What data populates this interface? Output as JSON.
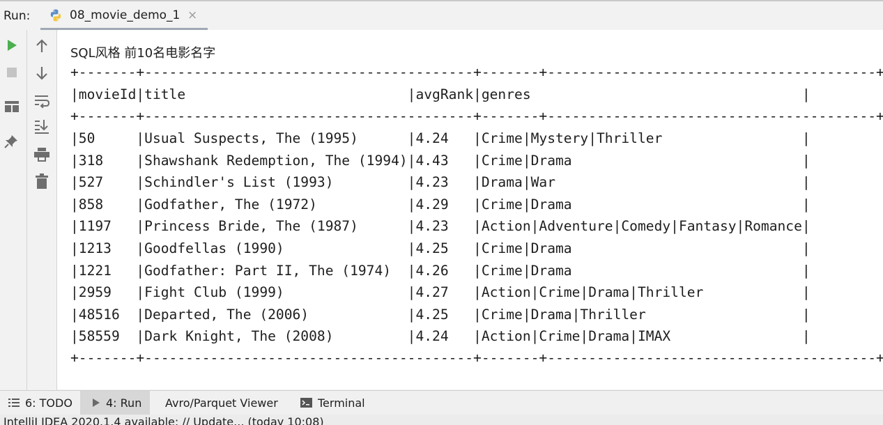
{
  "run_panel": {
    "label": "Run:",
    "tab_name": "08_movie_demo_1",
    "tab_close": "×"
  },
  "toolbar_left": [
    "rerun-icon",
    "stop-icon",
    "layout-icon",
    "pin-icon"
  ],
  "toolbar_right": [
    "up-arrow-icon",
    "down-arrow-icon",
    "soft-wrap-icon",
    "scroll-to-end-icon",
    "print-icon",
    "trash-icon"
  ],
  "console": {
    "heading": "SQL风格 前10名电影名字",
    "border": "+-------+----------------------------------------+-------+----------------------------------------+",
    "columns": [
      "movieId",
      "title",
      "avgRank",
      "genres"
    ],
    "rows": [
      [
        "50",
        "Usual Suspects, The (1995)",
        "4.24",
        "Crime|Mystery|Thriller"
      ],
      [
        "318",
        "Shawshank Redemption, The (1994)",
        "4.43",
        "Crime|Drama"
      ],
      [
        "527",
        "Schindler's List (1993)",
        "4.23",
        "Drama|War"
      ],
      [
        "858",
        "Godfather, The (1972)",
        "4.29",
        "Crime|Drama"
      ],
      [
        "1197",
        "Princess Bride, The (1987)",
        "4.23",
        "Action|Adventure|Comedy|Fantasy|Romance"
      ],
      [
        "1213",
        "Goodfellas (1990)",
        "4.25",
        "Crime|Drama"
      ],
      [
        "1221",
        "Godfather: Part II, The (1974)",
        "4.26",
        "Crime|Drama"
      ],
      [
        "2959",
        "Fight Club (1999)",
        "4.27",
        "Action|Crime|Drama|Thriller"
      ],
      [
        "48516",
        "Departed, The (2006)",
        "4.25",
        "Crime|Drama|Thriller"
      ],
      [
        "58559",
        "Dark Knight, The (2008)",
        "4.24",
        "Action|Crime|Drama|IMAX"
      ]
    ]
  },
  "bottom_tabs": [
    {
      "label": "6: TODO",
      "icon": "list-icon",
      "active": false
    },
    {
      "label": "4: Run",
      "icon": "play-icon",
      "active": true
    },
    {
      "label": "Avro/Parquet Viewer",
      "icon": "",
      "active": false
    },
    {
      "label": "Terminal",
      "icon": "terminal-icon",
      "active": false
    }
  ],
  "status_bar": {
    "text": "IntelliJ IDEA 2020.1.4 available: // Update... (today 10:08)"
  },
  "colors": {
    "run_green": "#4caf50",
    "icon_gray": "#6e6e6e",
    "active_tab_bg": "#d7d7d7"
  }
}
